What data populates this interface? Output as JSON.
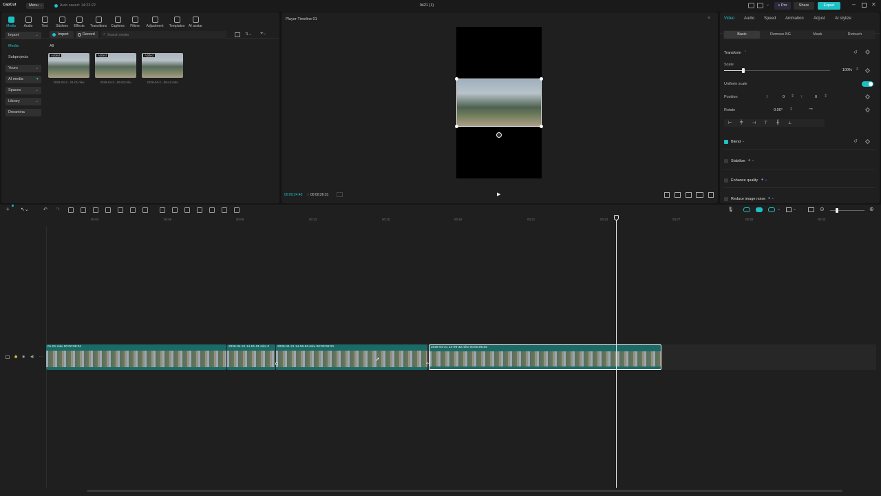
{
  "titlebar": {
    "logo": "CapCut",
    "menu_label": "Menu",
    "autosave": "Auto saved: 14:23:22",
    "project_title": "0421 (1)",
    "pro_label": "Pro",
    "share_label": "Share",
    "export_label": "Export"
  },
  "toolbar": {
    "items": [
      {
        "label": "Media",
        "icon": "media-icon"
      },
      {
        "label": "Audio",
        "icon": "audio-icon"
      },
      {
        "label": "Text",
        "icon": "text-icon"
      },
      {
        "label": "Stickers",
        "icon": "stickers-icon"
      },
      {
        "label": "Effects",
        "icon": "effects-icon"
      },
      {
        "label": "Transitions",
        "icon": "transitions-icon"
      },
      {
        "label": "Captions",
        "icon": "captions-icon"
      },
      {
        "label": "Filters",
        "icon": "filters-icon"
      },
      {
        "label": "Adjustment",
        "icon": "adjustment-icon"
      },
      {
        "label": "Templates",
        "icon": "templates-icon"
      },
      {
        "label": "AI avatar",
        "icon": "ai-avatar-icon"
      }
    ]
  },
  "sidebar": {
    "items": [
      {
        "label": "Import"
      },
      {
        "label": "Media"
      },
      {
        "label": "Subprojects"
      },
      {
        "label": "Yours"
      },
      {
        "label": "AI media"
      },
      {
        "label": "Spaces"
      },
      {
        "label": "Library"
      },
      {
        "label": "Dreamina"
      }
    ]
  },
  "media": {
    "import_label": "Import",
    "record_label": "Record",
    "search_placeholder": "Search media",
    "filter_label": "All",
    "items": [
      {
        "badge": "Added",
        "name": "2026-04-2...01-01.mkv"
      },
      {
        "badge": "Added",
        "name": "2026-04-2...06-53.mkv"
      },
      {
        "badge": "Added",
        "name": "2026-04-2...09-42.mkv"
      }
    ]
  },
  "player": {
    "title": "Player-Timeline 01",
    "current_time": "00:00:24:40",
    "total_time": "00:00:26:31"
  },
  "inspector": {
    "tabs": [
      "Video",
      "Audio",
      "Speed",
      "Animation",
      "Adjust",
      "AI stylize"
    ],
    "subtabs": [
      "Basic",
      "Remove BG",
      "Mask",
      "Retouch"
    ],
    "transform_label": "Transform",
    "scale_label": "Scale",
    "scale_value": "100%",
    "scale_fraction": 0.18,
    "uniform_scale_label": "Uniform scale",
    "position_label": "Position",
    "pos_x_label": "X",
    "pos_x": "0",
    "pos_y_label": "Y",
    "pos_y": "0",
    "rotate_label": "Rotate",
    "rotate_value": "0.00°",
    "blend_label": "Blend",
    "stabilize_label": "Stabilize",
    "enhance_label": "Enhance quality",
    "reduce_noise_label": "Reduce image noise"
  },
  "timeline": {
    "ruler": [
      "00:03",
      "00:06",
      "00:09",
      "00:12",
      "00:15",
      "00:18",
      "00:21",
      "00:24",
      "00:27",
      "00:30",
      "00:33"
    ],
    "clips": [
      {
        "name": "01-01.mkv  00:00:08:34"
      },
      {
        "name": "2026-04-21 14-01-01.mkv  0"
      },
      {
        "name": "2026-04-21 14-06-53.mkv  00:00:06:20"
      },
      {
        "name": "2026-04-21 14-09-42.mkv  00:00:09:35"
      }
    ]
  },
  "colors": {
    "accent": "#1fc0c4",
    "clip": "#1a6b68",
    "panel": "#1f1f1f"
  }
}
